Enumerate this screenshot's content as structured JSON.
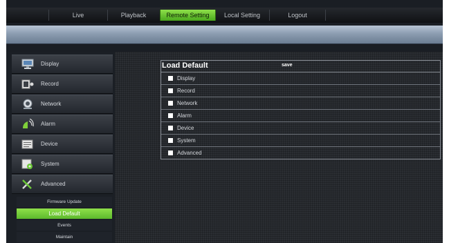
{
  "nav": {
    "tabs": [
      {
        "label": "Live"
      },
      {
        "label": "Playback"
      },
      {
        "label": "Remote Setting",
        "active": true
      },
      {
        "label": "Local Setting"
      },
      {
        "label": "Logout"
      }
    ]
  },
  "sidebar": {
    "items": [
      {
        "label": "Display",
        "icon": "monitor-icon"
      },
      {
        "label": "Record",
        "icon": "record-icon"
      },
      {
        "label": "Network",
        "icon": "network-icon"
      },
      {
        "label": "Alarm",
        "icon": "alarm-icon"
      },
      {
        "label": "Device",
        "icon": "device-icon"
      },
      {
        "label": "System",
        "icon": "system-icon"
      },
      {
        "label": "Advanced",
        "icon": "tools-icon"
      }
    ],
    "subitems": [
      {
        "label": "Firmware Update"
      },
      {
        "label": "Load Default",
        "active": true
      },
      {
        "label": "Events"
      },
      {
        "label": "Maintain"
      }
    ]
  },
  "panel": {
    "title": "Load Default",
    "save_label": "save",
    "options": [
      {
        "label": "Display"
      },
      {
        "label": "Record"
      },
      {
        "label": "Network"
      },
      {
        "label": "Alarm"
      },
      {
        "label": "Device"
      },
      {
        "label": "System"
      },
      {
        "label": "Advanced"
      }
    ]
  },
  "colors": {
    "accent_green": "#6cc837",
    "background": "#1a1e24",
    "blue_bar": "#8c9db1"
  }
}
